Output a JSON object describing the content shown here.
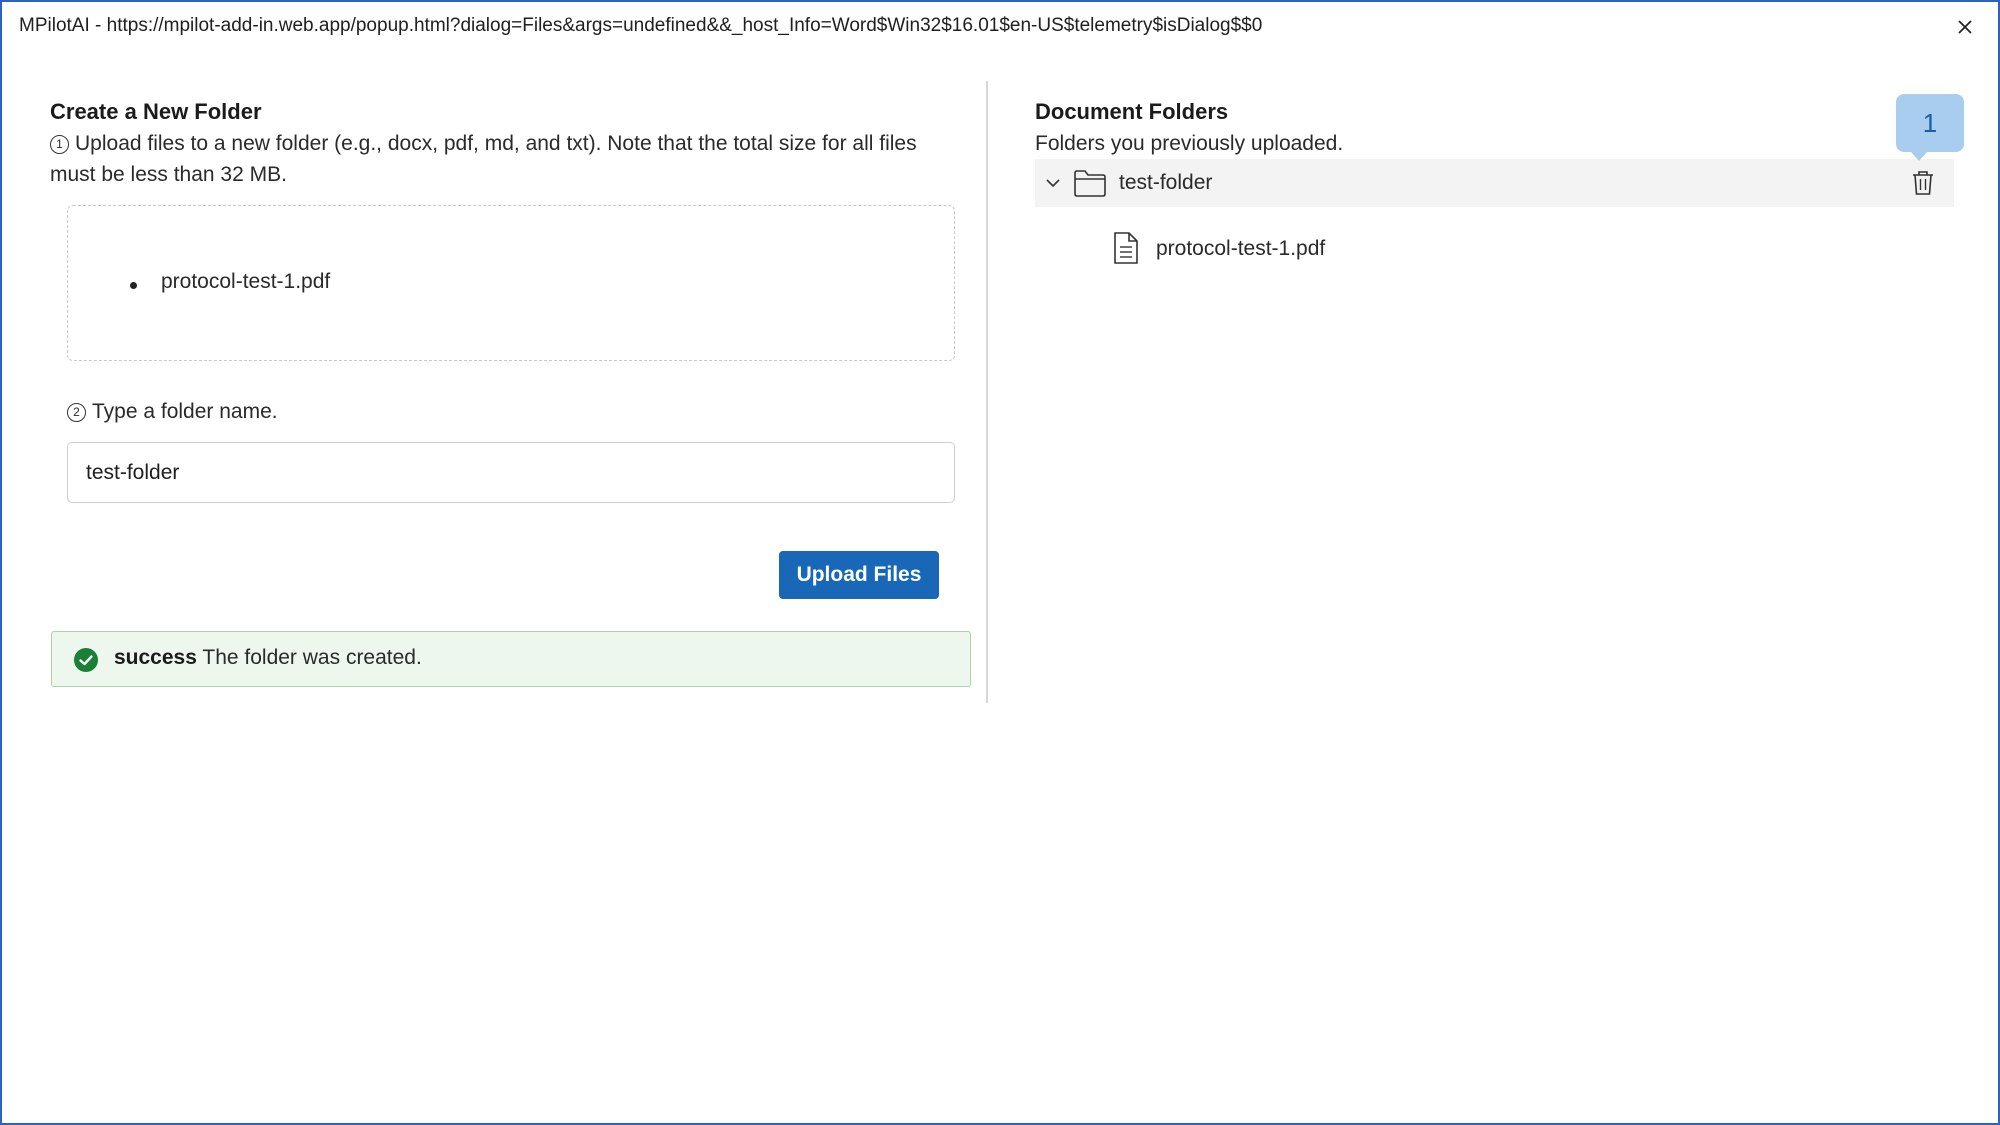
{
  "window": {
    "title": "MPilotAI - https://mpilot-add-in.web.app/popup.html?dialog=Files&args=undefined&&_host_Info=Word$Win32$16.01$en-US$telemetry$isDialog$$0",
    "close_icon": "close-icon"
  },
  "create_folder": {
    "heading": "Create a New Folder",
    "step1_marker": "1",
    "step1_text": "Upload files to a new folder (e.g., docx, pdf, md, and txt). Note that the total size for all files must be less than 32 MB.",
    "selected_files": [
      "protocol-test-1.pdf"
    ],
    "step2_marker": "2",
    "step2_text": "Type a folder name.",
    "folder_name_value": "test-folder",
    "upload_button_label": "Upload Files",
    "alert": {
      "status": "success",
      "message": "The folder was created.",
      "icon": "check-circle-icon",
      "color": "#1a7f37"
    }
  },
  "document_folders": {
    "heading": "Document Folders",
    "subtitle": "Folders you previously uploaded.",
    "folders": [
      {
        "name": "test-folder",
        "expanded": true,
        "files": [
          "protocol-test-1.pdf"
        ]
      }
    ],
    "badge_count": "1"
  },
  "colors": {
    "accent": "#1868b7",
    "window_border": "#2b63c4",
    "badge_bg": "#a8cdef",
    "alert_bg": "#eef7ee"
  }
}
